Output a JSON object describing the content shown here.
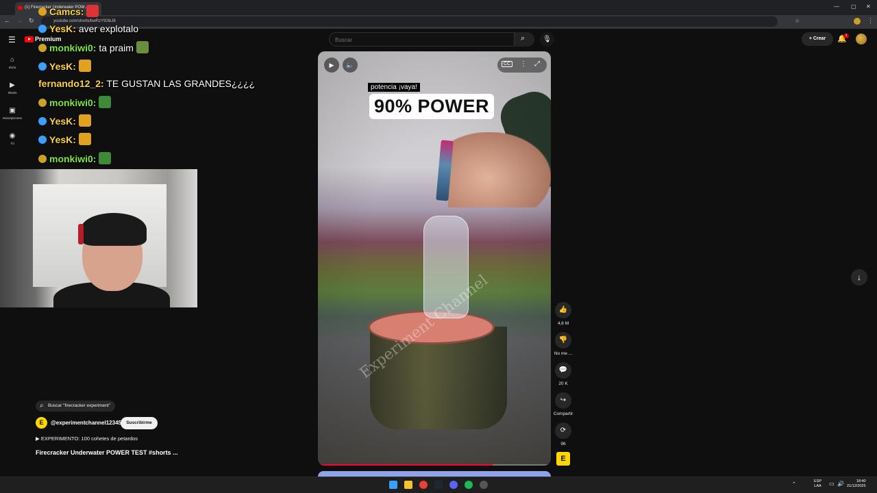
{
  "browser": {
    "tab_title": "(1) Firecracker Underwater POW...",
    "url": "youtube.com/shorts/bwRzY92tkJ8"
  },
  "youtube": {
    "logo_label": "Premium",
    "search_placeholder": "Buscar",
    "create_label": "Crear",
    "notifications_count": "1",
    "sidebar": {
      "items": [
        {
          "label": "Inicio",
          "icon": "home-icon"
        },
        {
          "label": "Shorts",
          "icon": "shorts-icon"
        },
        {
          "label": "Suscripciones",
          "icon": "subscriptions-icon"
        },
        {
          "label": "Tú",
          "icon": "you-icon"
        }
      ]
    }
  },
  "video": {
    "caption_small": "potencia ¡vaya!",
    "caption_big": "90% POWER",
    "watermark": "Experiment Channel",
    "progress": 0.75,
    "actions": {
      "likes": "4,6 M",
      "dislike": "No me ...",
      "comments": "20 K",
      "share": "Compartir",
      "remix": "96"
    },
    "channel_badge": "E"
  },
  "info": {
    "search_pill": "Buscar \"firecracker experiment\"",
    "channel_initial": "E",
    "channel_name": "@experimentchannel12345",
    "subscribe_label": "Suscribirme",
    "playlist": "EXPERIMENTO: 100 cohetes de petardos",
    "title": "Firecracker Underwater POWER TEST #shorts ..."
  },
  "chat": [
    {
      "user": "Camcs:",
      "text": "",
      "user_color": "#ffd23f"
    },
    {
      "user": "YesK:",
      "text": "aver explotalo",
      "user_color": "#ffd23f"
    },
    {
      "user": "monkiwi0:",
      "text": "ta praim",
      "user_color": "#7ee83f"
    },
    {
      "user": "YesK:",
      "text": "",
      "user_color": "#ffd23f"
    },
    {
      "user": "fernando12_2:",
      "text": "TE GUSTAN LAS GRANDES¿¿¿¿",
      "user_color": "#ffd23f"
    },
    {
      "user": "monkiwi0:",
      "text": "",
      "user_color": "#7ee83f"
    },
    {
      "user": "YesK:",
      "text": "",
      "user_color": "#ffd23f"
    },
    {
      "user": "YesK:",
      "text": "",
      "user_color": "#ffd23f"
    },
    {
      "user": "monkiwi0:",
      "text": "",
      "user_color": "#7ee83f"
    }
  ],
  "taskbar": {
    "lang_line1": "ESP",
    "lang_line2": "LAA",
    "time": "18:40",
    "date": "21/12/2025"
  }
}
